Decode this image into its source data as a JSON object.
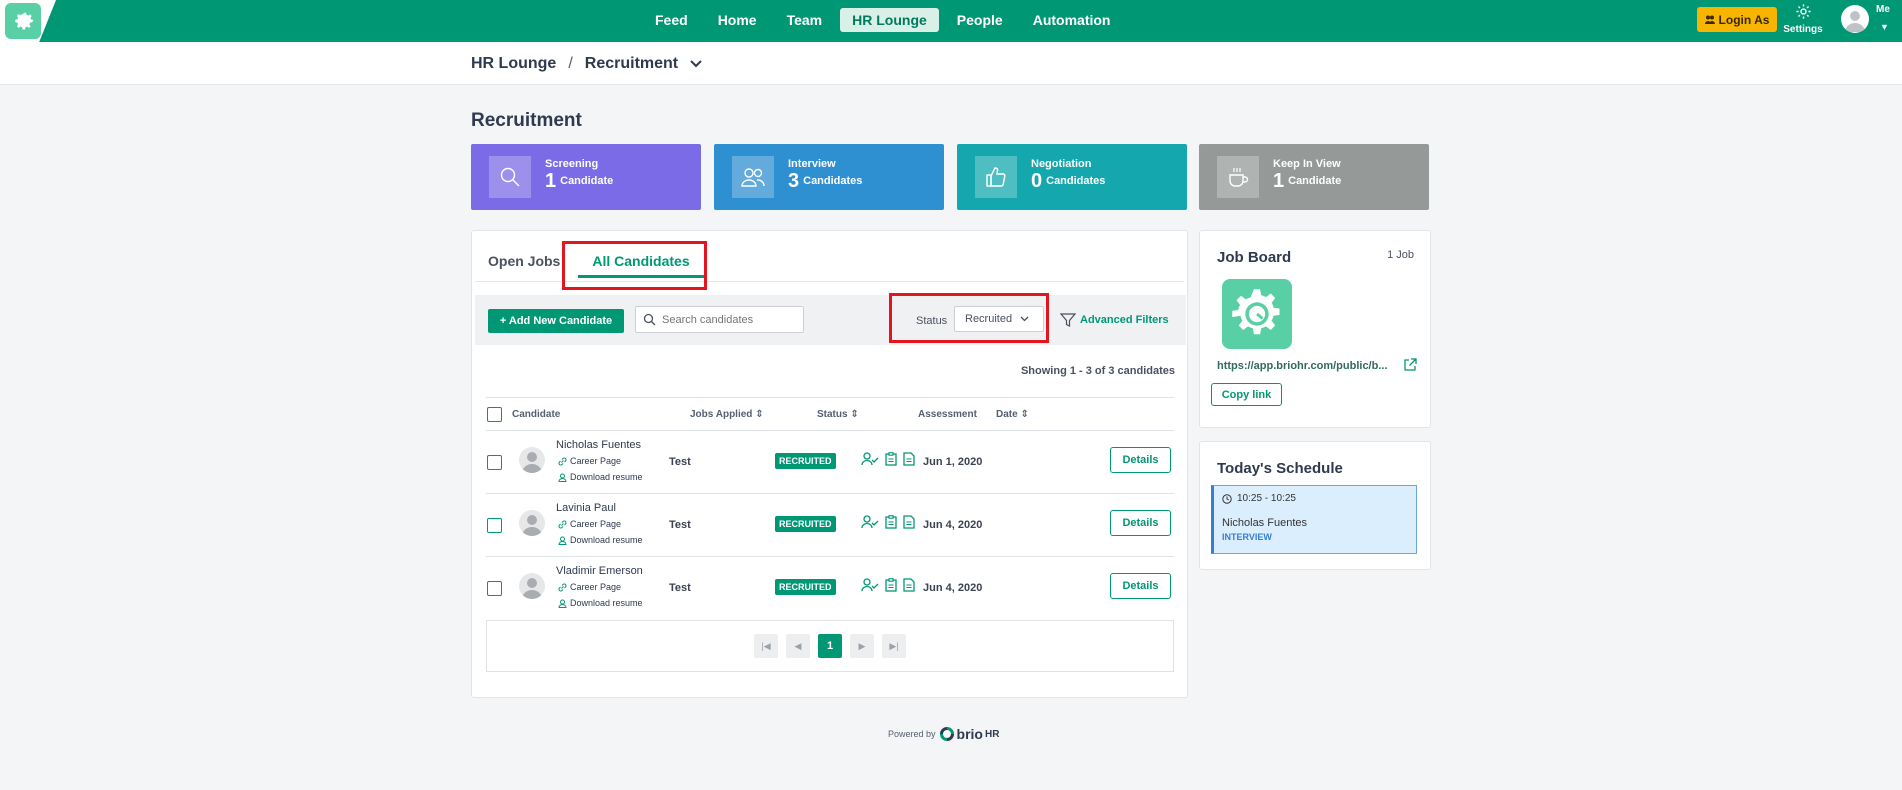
{
  "app": {
    "accent": "#009874",
    "logo_icon": "gear-icon"
  },
  "nav": {
    "items": [
      {
        "label": "Feed",
        "active": false
      },
      {
        "label": "Home",
        "active": false
      },
      {
        "label": "Team",
        "active": false
      },
      {
        "label": "HR Lounge",
        "active": true
      },
      {
        "label": "People",
        "active": false
      },
      {
        "label": "Automation",
        "active": false
      }
    ],
    "login_as": "Login As",
    "settings": "Settings",
    "me": "Me"
  },
  "breadcrumb": {
    "parent": "HR Lounge",
    "separator": "/",
    "current": "Recruitment"
  },
  "page_title": "Recruitment",
  "stats": [
    {
      "name": "Screening",
      "count": "1",
      "unit": "Candidate",
      "color": "#7b6be6",
      "icon": "search-icon"
    },
    {
      "name": "Interview",
      "count": "3",
      "unit": "Candidates",
      "color": "#2e8fd1",
      "icon": "users-icon"
    },
    {
      "name": "Negotiation",
      "count": "0",
      "unit": "Candidates",
      "color": "#14a8ae",
      "icon": "thumbs-up-icon"
    },
    {
      "name": "Keep In View",
      "count": "1",
      "unit": "Candidate",
      "color": "#959a99",
      "icon": "coffee-icon"
    }
  ],
  "tabs": [
    {
      "label": "Open Jobs",
      "active": false
    },
    {
      "label": "All Candidates",
      "active": true
    }
  ],
  "toolbar": {
    "add_label": "+ Add New Candidate",
    "search_placeholder": "Search candidates",
    "status_label": "Status",
    "status_value": "Recruited",
    "advanced_filters": "Advanced Filters"
  },
  "showing": "Showing 1 - 3 of 3 candidates",
  "table": {
    "headers": {
      "candidate": "Candidate",
      "jobs": "Jobs Applied",
      "status": "Status",
      "assessment": "Assessment",
      "date": "Date"
    },
    "rows": [
      {
        "name": "Nicholas Fuentes",
        "source": "Career Page",
        "resume": "Download resume",
        "job": "Test",
        "status": "RECRUITED",
        "date": "Jun 1, 2020",
        "action": "Details"
      },
      {
        "name": "Lavinia Paul",
        "source": "Career Page",
        "resume": "Download resume",
        "job": "Test",
        "status": "RECRUITED",
        "date": "Jun 4, 2020",
        "action": "Details"
      },
      {
        "name": "Vladimir Emerson",
        "source": "Career Page",
        "resume": "Download resume",
        "job": "Test",
        "status": "RECRUITED",
        "date": "Jun 4, 2020",
        "action": "Details"
      }
    ]
  },
  "pagination": {
    "current": "1"
  },
  "job_board": {
    "title": "Job Board",
    "count": "1 Job",
    "url": "https://app.briohr.com/public/b...",
    "copy_label": "Copy link"
  },
  "schedule": {
    "title": "Today's Schedule",
    "time": "10:25 - 10:25",
    "name": "Nicholas Fuentes",
    "type": "INTERVIEW"
  },
  "footer": {
    "powered_by": "Powered by",
    "brand_main": "brio",
    "brand_suffix": "HR"
  }
}
